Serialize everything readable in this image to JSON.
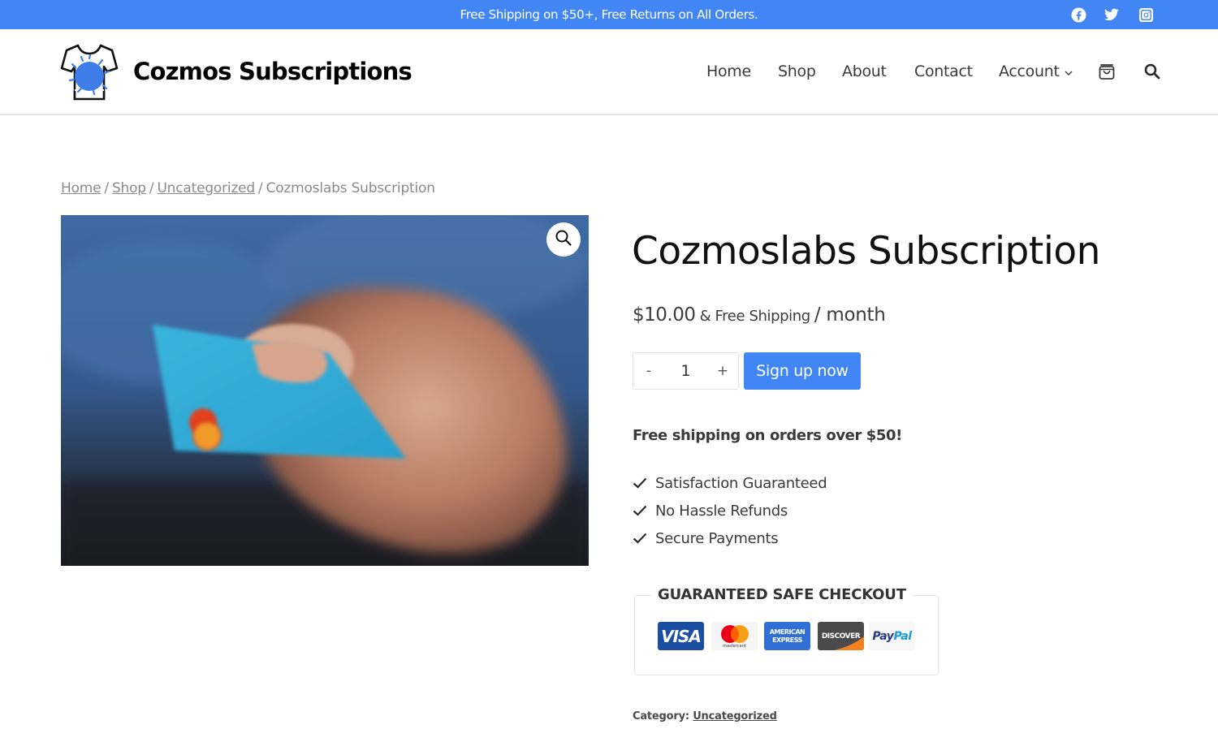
{
  "topbar": {
    "announcement": "Free Shipping on $50+, Free Returns on All Orders.",
    "social": [
      {
        "name": "facebook",
        "icon": "facebook-icon"
      },
      {
        "name": "twitter",
        "icon": "twitter-icon"
      },
      {
        "name": "instagram",
        "icon": "instagram-icon"
      }
    ],
    "background": "#4285f4"
  },
  "header": {
    "site_title": "Cozmos Subscriptions",
    "logo_icon": "tshirt-splash-logo",
    "nav": [
      {
        "label": "Home"
      },
      {
        "label": "Shop"
      },
      {
        "label": "About"
      },
      {
        "label": "Contact"
      },
      {
        "label": "Account",
        "has_dropdown": true
      }
    ],
    "cart_icon": "shopping-bag-icon",
    "search_icon": "search-icon"
  },
  "breadcrumb": {
    "items": [
      {
        "label": "Home",
        "link": true
      },
      {
        "label": "Shop",
        "link": true
      },
      {
        "label": "Uncategorized",
        "link": true
      },
      {
        "label": "Cozmoslabs Subscription",
        "link": false
      }
    ],
    "separator": "/"
  },
  "product": {
    "image_alt": "Hand holding a blue debit card",
    "zoom_icon": "magnifier-icon",
    "title": "Cozmoslabs Subscription",
    "price": "$10.00",
    "shipping_note": "& Free Shipping",
    "period": "/ month",
    "quantity": {
      "value": "1",
      "decrement": "-",
      "increment": "+"
    },
    "cta_label": "Sign up now",
    "free_shipping_notice": "Free shipping on orders over $50!",
    "features": [
      "Satisfaction Guaranteed",
      "No Hassle Refunds",
      "Secure Payments"
    ],
    "safe_checkout": {
      "title": "GUARANTEED SAFE CHECKOUT",
      "methods": [
        {
          "name": "visa",
          "label": "VISA"
        },
        {
          "name": "mastercard",
          "label": "mastercard"
        },
        {
          "name": "american-express",
          "label_top": "AMERICAN",
          "label_bottom": "EXPRESS"
        },
        {
          "name": "discover",
          "label": "DISCOVER"
        },
        {
          "name": "paypal",
          "label_a": "Pay",
          "label_b": "Pal"
        }
      ]
    },
    "category_label": "Category:",
    "category_value": "Uncategorized"
  },
  "colors": {
    "accent": "#4285f4",
    "text_dark": "#111111",
    "text_body": "#3a3a3a",
    "muted": "#8a8a8a"
  }
}
